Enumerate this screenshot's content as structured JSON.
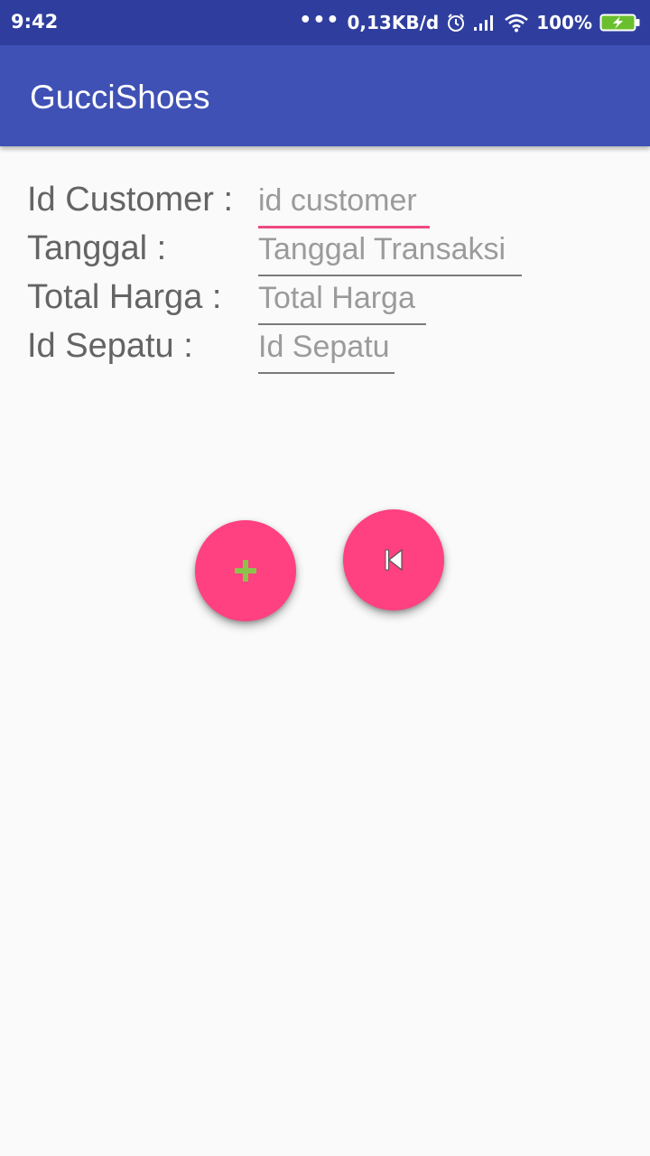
{
  "status_bar": {
    "time": "9:42",
    "dots": "•••",
    "network_speed": "0,13KB/d",
    "battery_percent": "100%",
    "icons": [
      "alarm-icon",
      "signal-icon",
      "wifi-icon",
      "battery-charging-icon"
    ]
  },
  "app_bar": {
    "title": "GucciShoes"
  },
  "form": {
    "fields": [
      {
        "label": "Id Customer :",
        "placeholder": "id customer",
        "value": "",
        "focused": true
      },
      {
        "label": "Tanggal :",
        "placeholder": "Tanggal Transaksi",
        "value": ""
      },
      {
        "label": "Total Harga :",
        "placeholder": "Total Harga",
        "value": ""
      },
      {
        "label": "Id Sepatu :",
        "placeholder": "Id Sepatu",
        "value": ""
      }
    ]
  },
  "buttons": {
    "add": {
      "icon": "plus-icon"
    },
    "back": {
      "icon": "skip-previous-icon"
    }
  },
  "colors": {
    "status_bar": "#2f3e9e",
    "app_bar": "#3f51b5",
    "accent": "#ff4081",
    "focus_underline": "#ef4a82",
    "plus_icon": "#8bc34a",
    "background": "#fafafa"
  }
}
